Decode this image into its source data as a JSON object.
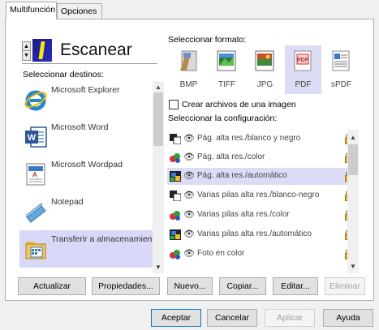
{
  "tabs": [
    {
      "label": "Multifunción",
      "active": true
    },
    {
      "label": "Opciones",
      "active": false
    }
  ],
  "scan": {
    "title": "Escanear"
  },
  "labels": {
    "destinations": "Seleccionar destinos:",
    "format": "Seleccionar formato:",
    "create_per_image": "Crear archivos de una imagen",
    "configuration": "Seleccionar la configuración:"
  },
  "destinations": [
    {
      "label": "Microsoft Explorer",
      "icon": "internet-explorer-icon",
      "selected": false
    },
    {
      "label": "Microsoft Word",
      "icon": "word-icon",
      "selected": false
    },
    {
      "label": "Microsoft Wordpad",
      "icon": "wordpad-icon",
      "selected": false
    },
    {
      "label": "Notepad",
      "icon": "notepad-icon",
      "selected": false
    },
    {
      "label": "Transferir a almacenamiento",
      "icon": "storage-folder-icon",
      "selected": true
    }
  ],
  "formats": [
    {
      "label": "BMP",
      "icon": "bmp-icon",
      "selected": false
    },
    {
      "label": "TIFF",
      "icon": "tiff-icon",
      "selected": false
    },
    {
      "label": "JPG",
      "icon": "jpg-icon",
      "selected": false
    },
    {
      "label": "PDF",
      "icon": "pdf-icon",
      "selected": true
    },
    {
      "label": "sPDF",
      "icon": "spdf-icon",
      "selected": false
    }
  ],
  "configurations": [
    {
      "label": "Pág. alta res./blanco y negro",
      "icon": "bw-icon",
      "selected": false
    },
    {
      "label": "Pág. alta res./color",
      "icon": "color-icon",
      "selected": false
    },
    {
      "label": "Pág. alta res./automático",
      "icon": "auto-icon",
      "selected": true
    },
    {
      "label": "Varias pilas alta res./blanco-negro",
      "icon": "bw-icon",
      "selected": false
    },
    {
      "label": "Varias pilas alta res./color",
      "icon": "color-icon",
      "selected": false
    },
    {
      "label": "Varias pilas alta res./automático",
      "icon": "auto-icon",
      "selected": false
    },
    {
      "label": "Foto en color",
      "icon": "color-icon",
      "selected": false
    }
  ],
  "buttons": {
    "refresh": "Actualizar",
    "properties": "Propiedades...",
    "new": "Nuevo...",
    "copy": "Copiar...",
    "edit": "Editar...",
    "delete": "Eliminar",
    "accept": "Aceptar",
    "cancel": "Cancelar",
    "apply": "Aplicar",
    "help": "Ayuda"
  },
  "colors": {
    "selection": "#dcdcf6",
    "accent_border": "#0078d7",
    "lock": "#e4b325"
  }
}
